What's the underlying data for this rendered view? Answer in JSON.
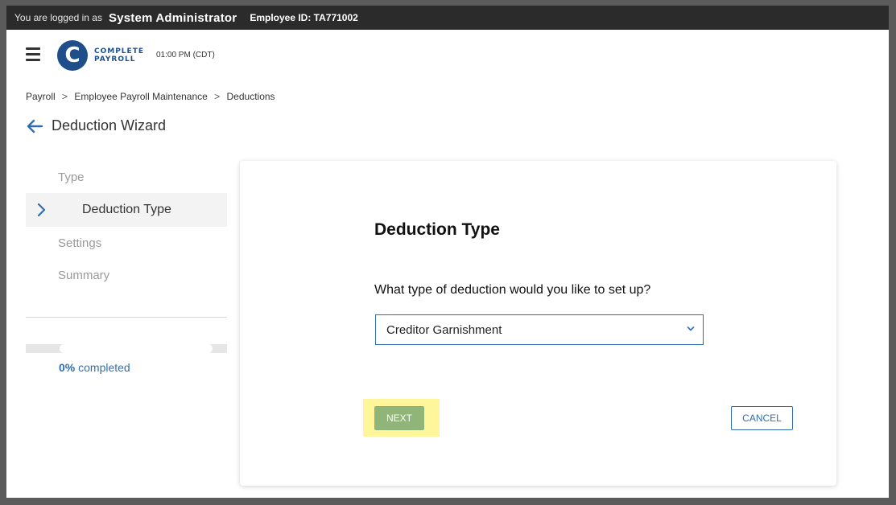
{
  "topbar": {
    "logged_in_text": "You are logged in as",
    "user_name": "System Administrator",
    "employee_id": "Employee ID: TA771002"
  },
  "header": {
    "logo_letter": "C",
    "logo_line1": "COMPLETE",
    "logo_line2": "PAYROLL",
    "time": "01:00 PM (CDT)"
  },
  "breadcrumb": {
    "items": [
      "Payroll",
      "Employee Payroll Maintenance",
      "Deductions"
    ],
    "separator": ">"
  },
  "wizard": {
    "title": "Deduction Wizard"
  },
  "steps": [
    {
      "label": "Type",
      "active": false
    },
    {
      "label": "Deduction Type",
      "active": true
    },
    {
      "label": "Settings",
      "active": false
    },
    {
      "label": "Summary",
      "active": false
    }
  ],
  "progress": {
    "percent_text": "0%",
    "suffix": "completed",
    "value_percent": 0
  },
  "card": {
    "title": "Deduction Type",
    "question": "What type of deduction would you like to set up?",
    "select_value": "Creditor Garnishment",
    "next_label": "NEXT",
    "cancel_label": "CANCEL"
  },
  "colors": {
    "brand": "#1e4f8a",
    "accent": "#2f6fb0",
    "next_button": "#8fb579",
    "highlight": "#fff59a",
    "topbar": "#2b2b2b"
  }
}
